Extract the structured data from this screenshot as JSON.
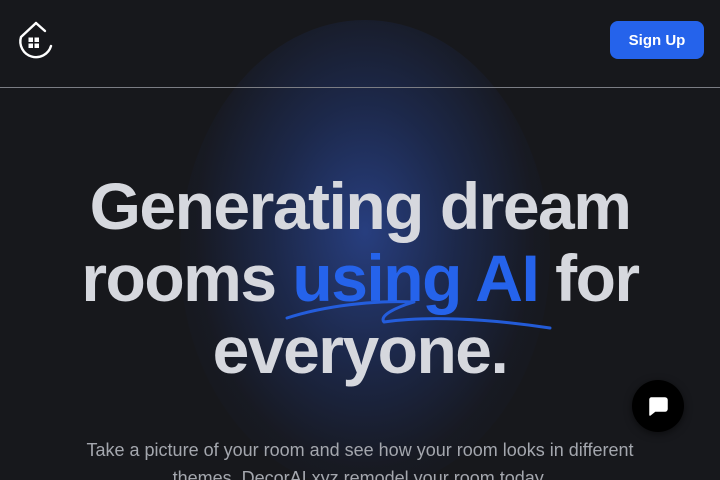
{
  "header": {
    "logo_icon": "house-drop-logo-icon",
    "signup_label": "Sign Up"
  },
  "hero": {
    "line1": "Generating dream",
    "line2_before": "rooms ",
    "line2_accent": "using AI",
    "line2_after": " for",
    "line3": "everyone.",
    "accent_color": "#2563eb"
  },
  "subtitle": {
    "line1": "Take a picture of your room and see how your room looks in different",
    "line2": "themes. DecorAI.xyz remodel your room today."
  },
  "chat": {
    "icon": "chat-bubble-icon"
  },
  "colors": {
    "background": "#17181c",
    "button": "#2563eb",
    "title": "#d6d8de",
    "subtitle": "#a4a7ae"
  }
}
